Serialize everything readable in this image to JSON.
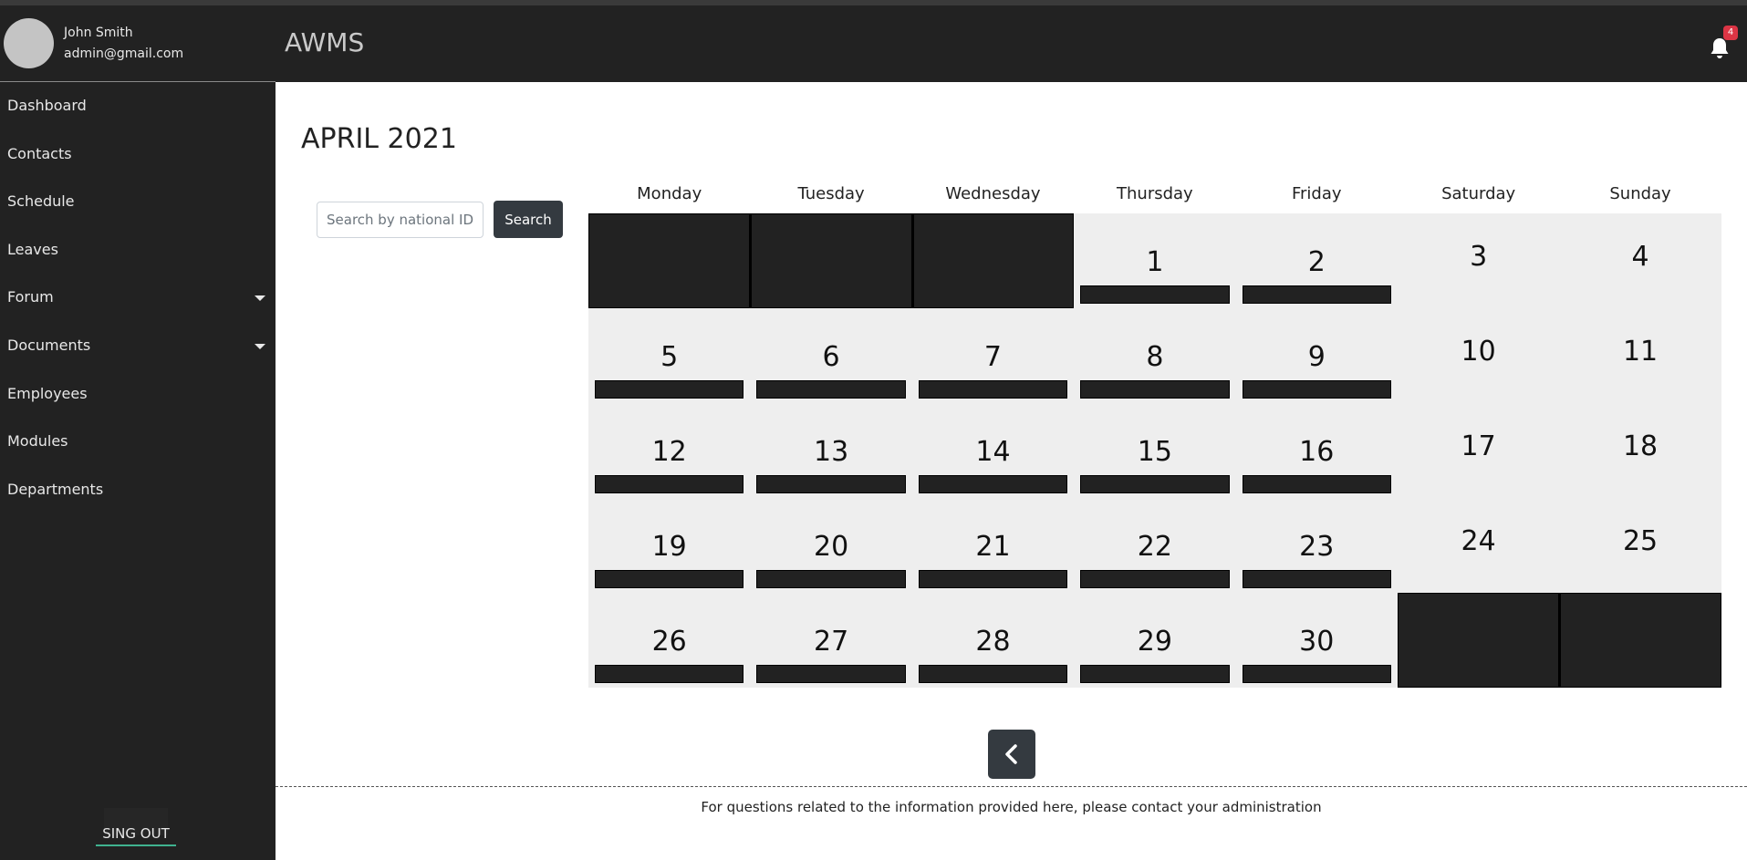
{
  "user": {
    "name": "John Smith",
    "email": "admin@gmail.com"
  },
  "sidebar": {
    "items": [
      {
        "label": "Dashboard",
        "dropdown": false
      },
      {
        "label": "Contacts",
        "dropdown": false
      },
      {
        "label": "Schedule",
        "dropdown": false
      },
      {
        "label": "Leaves",
        "dropdown": false
      },
      {
        "label": "Forum",
        "dropdown": true
      },
      {
        "label": "Documents",
        "dropdown": true
      },
      {
        "label": "Employees",
        "dropdown": false
      },
      {
        "label": "Modules",
        "dropdown": false
      },
      {
        "label": "Departments",
        "dropdown": false
      }
    ],
    "signout_label": "SING OUT"
  },
  "header": {
    "title": "AWMS",
    "notification_count": "4",
    "bell_icon": "bell-icon"
  },
  "calendar": {
    "month_title": "APRIL 2021",
    "weekdays": [
      "Monday",
      "Tuesday",
      "Wednesday",
      "Thursday",
      "Friday",
      "Saturday",
      "Sunday"
    ],
    "weeks": [
      [
        null,
        null,
        null,
        1,
        2,
        3,
        4
      ],
      [
        5,
        6,
        7,
        8,
        9,
        10,
        11
      ],
      [
        12,
        13,
        14,
        15,
        16,
        17,
        18
      ],
      [
        19,
        20,
        21,
        22,
        23,
        24,
        25
      ],
      [
        26,
        27,
        28,
        29,
        30,
        null,
        null
      ]
    ],
    "prev_icon": "chevron-left-icon"
  },
  "search": {
    "placeholder": "Search by national ID.",
    "value": "",
    "button_label": "Search"
  },
  "footer": {
    "text": "For questions related to the information provided here, please contact your administration"
  },
  "colors": {
    "sidebar_bg": "#222222",
    "cell_bg": "#eeeeee",
    "badge": "#dc3545",
    "signout_underline": "#3fb28f",
    "button": "#343a40"
  }
}
